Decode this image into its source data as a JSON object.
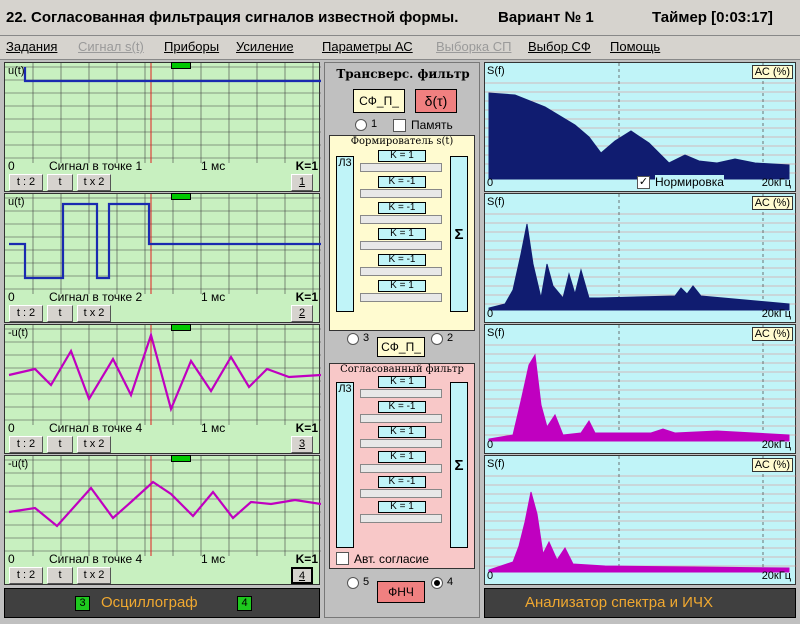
{
  "title": {
    "text": "22. Согласованная фильтрация сигналов известной формы.",
    "variant": "Вариант № 1",
    "timer": "Таймер [0:03:17]"
  },
  "menu": [
    {
      "label": "Задания",
      "enabled": true
    },
    {
      "label": "Сигнал s(t)",
      "enabled": false
    },
    {
      "label": "Приборы",
      "enabled": true
    },
    {
      "label": "Усиление",
      "enabled": true
    },
    {
      "label": "Параметры АС",
      "enabled": true
    },
    {
      "label": "Выборка СП",
      "enabled": false
    },
    {
      "label": "Выбор СФ",
      "enabled": true
    },
    {
      "label": "Помощь",
      "enabled": true
    }
  ],
  "oscilloscope": {
    "channels": [
      {
        "ylabel": "u(t)",
        "x0": "0",
        "signal": "Сигнал в точке 1",
        "x1": "1 мс",
        "k": "K=1",
        "btn_t2": "t : 2",
        "btn_t": "t",
        "btn_tx2": "t x 2",
        "btn_ch": "1"
      },
      {
        "ylabel": "u(t)",
        "x0": "0",
        "signal": "Сигнал в точке 2",
        "x1": "1 мс",
        "k": "K=1",
        "btn_t2": "t : 2",
        "btn_t": "t",
        "btn_tx2": "t x 2",
        "btn_ch": "2"
      },
      {
        "ylabel": "-u(t)",
        "x0": "0",
        "signal": "Сигнал в точке 4",
        "x1": "1 мс",
        "k": "K=1",
        "btn_t2": "t : 2",
        "btn_t": "t",
        "btn_tx2": "t x 2",
        "btn_ch": "3"
      },
      {
        "ylabel": "-u(t)",
        "x0": "0",
        "signal": "Сигнал в точке 4",
        "x1": "1 мс",
        "k": "K=1",
        "btn_t2": "t : 2",
        "btn_t": "t",
        "btn_tx2": "t x 2",
        "btn_ch": "4"
      }
    ],
    "footer_label": "Осциллограф",
    "footer_left_num": "3",
    "footer_right_num": "4"
  },
  "center": {
    "title": "Трансверс. фильтр",
    "sf_top": "СФ_П_",
    "delta": "δ(τ)",
    "radio1": "1",
    "memory_label": "Память",
    "former_title": "Формирователь s(t)",
    "lz": "Л3",
    "sum": "Σ",
    "former_k": [
      "K = 1",
      "K = -1",
      "K = -1",
      "K = 1",
      "K = -1",
      "K = 1"
    ],
    "radio3": "3",
    "radio2": "2",
    "sf_mid": "СФ_П_",
    "matched_title": "Согласованный фильтр",
    "matched_k": [
      "K = 1",
      "K = -1",
      "K = 1",
      "K = 1",
      "K = -1",
      "K = 1"
    ],
    "auto_label": "Авт. согласие",
    "radio5": "5",
    "radio4": "4",
    "fnch": "ФНЧ"
  },
  "spectrum": {
    "panels": [
      {
        "ylabel": "S(f)",
        "ac": "АС (%)",
        "x0": "0",
        "x1": "20кГц",
        "norm_label": "Нормировка"
      },
      {
        "ylabel": "S(f)",
        "ac": "АС (%)",
        "x0": "0",
        "x1": "20кГц"
      },
      {
        "ylabel": "S(f)",
        "ac": "АС (%)",
        "x0": "0",
        "x1": "20кГц"
      },
      {
        "ylabel": "S(f)",
        "ac": "АС (%)",
        "x0": "0",
        "x1": "20кГц"
      }
    ],
    "footer_label": "Анализатор спектра и ИЧХ"
  },
  "colors": {
    "osc_bg": "#c8f0c0",
    "spec_bg": "#c0f4f8",
    "signal_blue": "#1a2ab0",
    "signal_magenta": "#c000c0",
    "spectrum_navy": "#101c70",
    "spectrum_magenta": "#c000c0",
    "accent_orange": "#f0a830"
  }
}
